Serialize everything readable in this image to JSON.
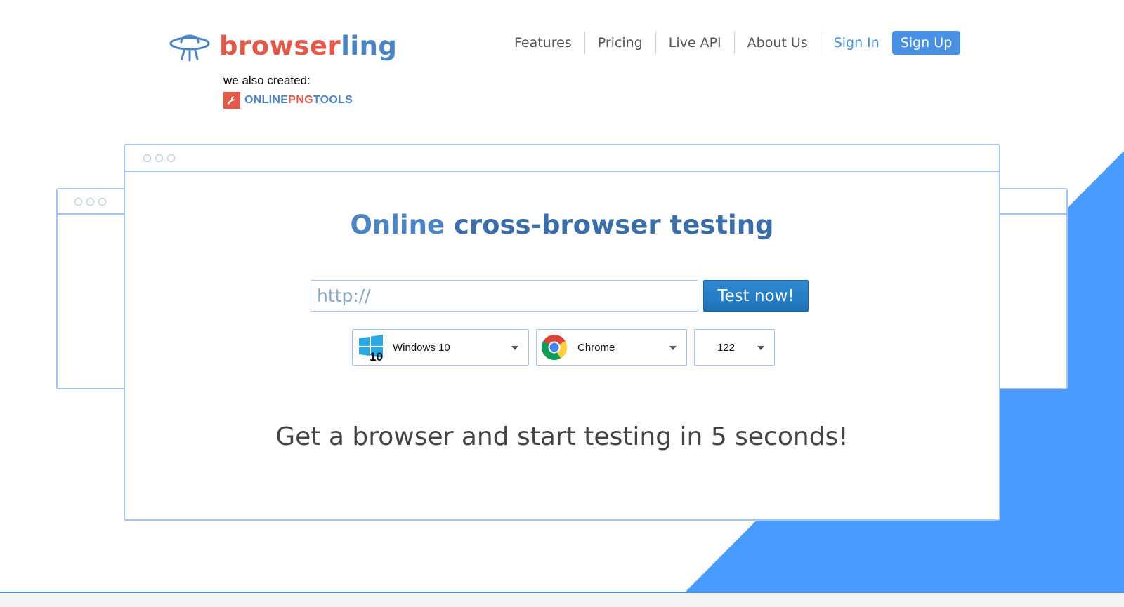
{
  "colors": {
    "brand_red": "#e35a4a",
    "brand_blue": "#4b84c2",
    "accent_blue": "#4a90e2",
    "frame_blue": "#a7c4ea"
  },
  "header": {
    "logo": {
      "part1": "browser",
      "part2": "ling",
      "icon": "ufo-icon"
    },
    "also_created": {
      "label": "we also created:",
      "tool": {
        "part1": "ONLINE",
        "part2": "PNG",
        "part3": "TOOLS",
        "icon": "wrench-icon"
      }
    },
    "nav": {
      "features": "Features",
      "pricing": "Pricing",
      "live_api": "Live API",
      "about": "About Us",
      "sign_in": "Sign In",
      "sign_up": "Sign Up"
    }
  },
  "main": {
    "headline": {
      "light": "Online ",
      "strong": "cross-browser testing"
    },
    "url": {
      "placeholder": "http://",
      "value": ""
    },
    "test_button": "Test now!",
    "os_select": {
      "selected": "Windows 10",
      "icon": "windows-10-icon"
    },
    "browser_select": {
      "selected": "Chrome",
      "icon": "chrome-icon"
    },
    "version_select": {
      "selected": "122"
    },
    "tagline": "Get a browser and start testing in 5 seconds!"
  }
}
